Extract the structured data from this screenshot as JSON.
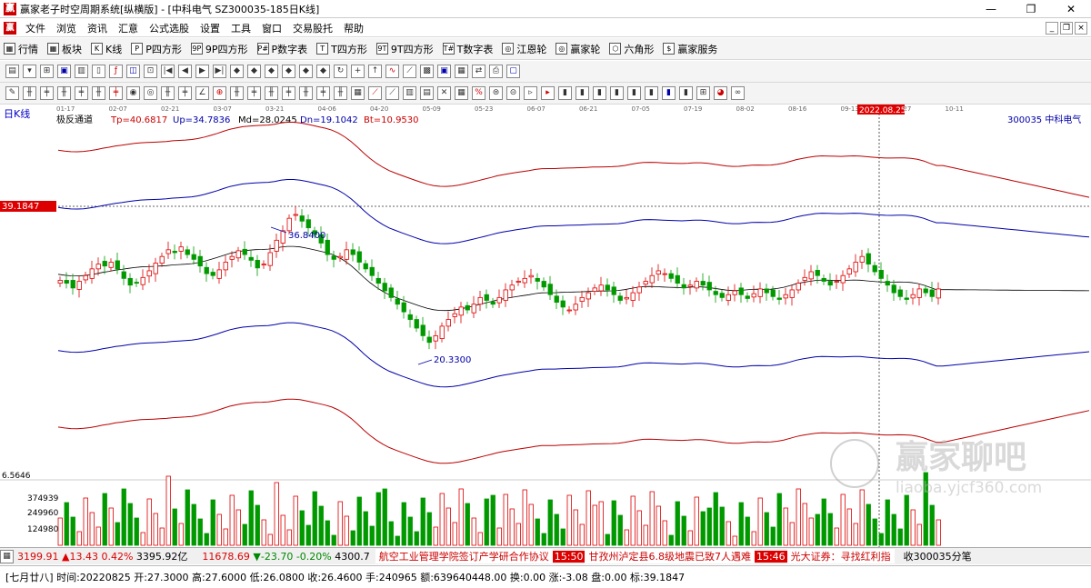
{
  "window": {
    "title": "赢家老子时空周期系统[纵横版] - [中科电气  SZ300035-185日K线]",
    "minimize": "—",
    "restore": "❐",
    "close": "✕"
  },
  "menu": {
    "items": [
      "文件",
      "浏览",
      "资讯",
      "汇意",
      "公式选股",
      "设置",
      "工具",
      "窗口",
      "交易股托",
      "帮助"
    ]
  },
  "toolbar1": {
    "items": [
      {
        "icon": "▦",
        "label": "行情"
      },
      {
        "icon": "▦",
        "label": "板块"
      },
      {
        "icon": "K",
        "label": "K线"
      },
      {
        "icon": "P",
        "label": "P四方形"
      },
      {
        "icon": "9P",
        "label": "9P四方形"
      },
      {
        "icon": "P#",
        "label": "P数字表"
      },
      {
        "icon": "T",
        "label": "T四方形"
      },
      {
        "icon": "9T",
        "label": "9T四方形"
      },
      {
        "icon": "T#",
        "label": "T数字表"
      },
      {
        "icon": "◎",
        "label": "江恩轮"
      },
      {
        "icon": "◎",
        "label": "赢家轮"
      },
      {
        "icon": "⬡",
        "label": "六角形"
      },
      {
        "icon": "$",
        "label": "赢家服务"
      }
    ]
  },
  "chart_header": {
    "period": "日K线",
    "indicator": "极反通道",
    "tp": "Tp=40.6817",
    "up": "Up=34.7836",
    "md": "Md=28.0245",
    "dn": "Dn=19.1042",
    "bt": "Bt=10.9530",
    "stock": "300035  中科电气",
    "price_tag": "39.1847",
    "cursor_date": "2022.08.25",
    "high_label": "36.8400",
    "low_label": "20.3300",
    "vol_axis_top": "6.5646",
    "vol_ticks": [
      "374939",
      "249960",
      "124980"
    ],
    "watermark_cn": "赢家聊吧",
    "watermark_url": "liaoba.yjcf360.com"
  },
  "chart_data": {
    "type": "candlestick",
    "x_ticks": [
      "01-17",
      "02-07",
      "02-21",
      "03-07",
      "03-21",
      "04-06",
      "04-20",
      "05-09",
      "05-23",
      "06-07",
      "06-21",
      "07-05",
      "07-19",
      "08-02",
      "08-16",
      "09-13",
      "09-27",
      "10-11"
    ],
    "y_range": [
      6.5,
      44
    ],
    "close_series": [
      27.3,
      27.0,
      26.5,
      27.2,
      27.8,
      28.5,
      29.0,
      28.8,
      29.2,
      28.5,
      27.5,
      26.8,
      27.0,
      27.6,
      28.3,
      29.1,
      29.8,
      30.5,
      30.2,
      30.8,
      30.0,
      29.5,
      28.8,
      28.0,
      27.8,
      28.4,
      29.2,
      29.8,
      30.4,
      30.0,
      29.4,
      28.6,
      29.0,
      30.2,
      31.5,
      32.5,
      33.8,
      34.2,
      33.5,
      32.8,
      32.1,
      31.2,
      30.0,
      29.5,
      29.8,
      30.5,
      30.0,
      29.2,
      28.5,
      27.8,
      27.0,
      26.2,
      25.5,
      24.8,
      24.0,
      23.2,
      22.3,
      21.5,
      20.8,
      21.5,
      22.5,
      23.2,
      23.8,
      24.5,
      24.2,
      24.8,
      25.5,
      25.2,
      24.8,
      25.5,
      26.3,
      26.8,
      27.2,
      27.5,
      27.8,
      27.2,
      26.6,
      25.8,
      25.0,
      24.5,
      24.2,
      24.8,
      25.5,
      26.0,
      26.5,
      26.8,
      26.3,
      25.8,
      25.2,
      25.5,
      26.0,
      26.6,
      27.2,
      27.8,
      28.3,
      28.0,
      27.5,
      27.0,
      26.5,
      26.8,
      27.2,
      26.8,
      26.3,
      25.8,
      25.5,
      25.8,
      26.2,
      25.8,
      25.4,
      25.9,
      26.4,
      26.0,
      25.6,
      25.3,
      25.8,
      26.3,
      27.0,
      27.6,
      28.2,
      27.8,
      27.2,
      26.8,
      27.2,
      27.8,
      28.5,
      29.2,
      29.8,
      29.0,
      28.2,
      27.5,
      26.8,
      26.0,
      25.6,
      25.3,
      25.8,
      26.4,
      26.0,
      25.6,
      26.4
    ]
  },
  "statusbar1": {
    "sh_index": "3199.91",
    "sh_change": "▲13.43",
    "sh_pct": "0.42%",
    "sh_amount": "3395.92亿",
    "sz_index": "11678.69",
    "sz_change": "▼-23.70",
    "sz_pct": "-0.20%",
    "sz_amount": "4300.7",
    "news1": "航空工业管理学院签订产学研合作协议",
    "time2": "15:50",
    "news2": "甘孜州泸定县6.8级地震已致7人遇难",
    "time3": "15:46",
    "news3": "光大证券：寻找红利指",
    "right": "收300035分笔"
  },
  "statusbar2": {
    "text": "[七月廿八] 时间:20220825 开:27.3000 高:27.6000 低:26.0800 收:26.4600 手:240965 额:639640448.00 换:0.00 涨:-3.08 盘:0.00 标:39.1847"
  }
}
